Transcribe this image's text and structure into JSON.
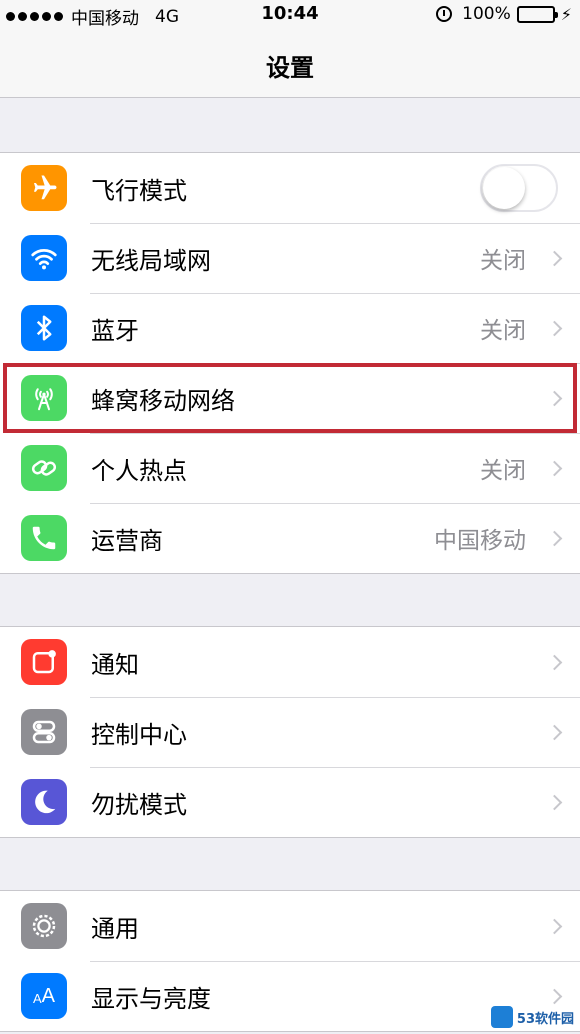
{
  "status_bar": {
    "carrier": "中国移动",
    "network": "4G",
    "time": "10:44",
    "battery": "100%",
    "battery_level": 1.0
  },
  "nav": {
    "title": "设置"
  },
  "groups": [
    {
      "rows": [
        {
          "label": "飞行模式",
          "icon": "airplane-icon",
          "color": "#ff9500",
          "control": "toggle",
          "toggle_on": false
        },
        {
          "label": "无线局域网",
          "icon": "wifi-icon",
          "color": "#007aff",
          "value": "关闭"
        },
        {
          "label": "蓝牙",
          "icon": "bluetooth-icon",
          "color": "#007aff",
          "value": "关闭"
        },
        {
          "label": "蜂窝移动网络",
          "icon": "cellular-icon",
          "color": "#4cd964",
          "highlighted": true
        },
        {
          "label": "个人热点",
          "icon": "hotspot-icon",
          "color": "#4cd964",
          "value": "关闭"
        },
        {
          "label": "运营商",
          "icon": "phone-icon",
          "color": "#4cd964",
          "value": "中国移动"
        }
      ]
    },
    {
      "rows": [
        {
          "label": "通知",
          "icon": "notifications-icon",
          "color": "#ff3b30"
        },
        {
          "label": "控制中心",
          "icon": "control-center-icon",
          "color": "#8e8e93"
        },
        {
          "label": "勿扰模式",
          "icon": "moon-icon",
          "color": "#5856d6"
        }
      ]
    },
    {
      "rows": [
        {
          "label": "通用",
          "icon": "gear-icon",
          "color": "#8e8e93"
        },
        {
          "label": "显示与亮度",
          "icon": "display-icon",
          "color": "#007aff"
        }
      ]
    }
  ],
  "highlight_color": "#c22a35",
  "watermark": {
    "text": "53软件园"
  }
}
